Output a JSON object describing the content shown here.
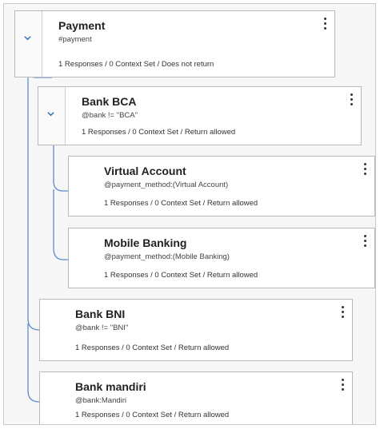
{
  "nodes": {
    "payment": {
      "title": "Payment",
      "condition": "#payment",
      "meta": "1 Responses / 0 Context Set / Does not return"
    },
    "bank_bca": {
      "title": "Bank BCA",
      "condition": "@bank != \"BCA\"",
      "meta": "1 Responses / 0 Context Set / Return allowed"
    },
    "virtual_account": {
      "title": "Virtual Account",
      "condition": "@payment_method:(Virtual Account)",
      "meta": "1 Responses / 0 Context Set / Return allowed"
    },
    "mobile_banking": {
      "title": "Mobile Banking",
      "condition": "@payment_method:(Mobile Banking)",
      "meta": "1 Responses / 0 Context Set / Return allowed"
    },
    "bank_bni": {
      "title": "Bank BNI",
      "condition": "@bank != \"BNI\"",
      "meta": "1 Responses / 0 Context Set / Return allowed"
    },
    "bank_mandiri": {
      "title": "Bank mandiri",
      "condition": "@bank:Mandiri",
      "meta": "1 Responses / 0 Context Set / Return allowed"
    }
  },
  "icons": {
    "expand": "chevron-down-icon",
    "menu": "overflow-menu-icon"
  },
  "colors": {
    "accent": "#2f6fbf",
    "tree_line": "#5a8ccf",
    "border": "#b9b9b9"
  }
}
